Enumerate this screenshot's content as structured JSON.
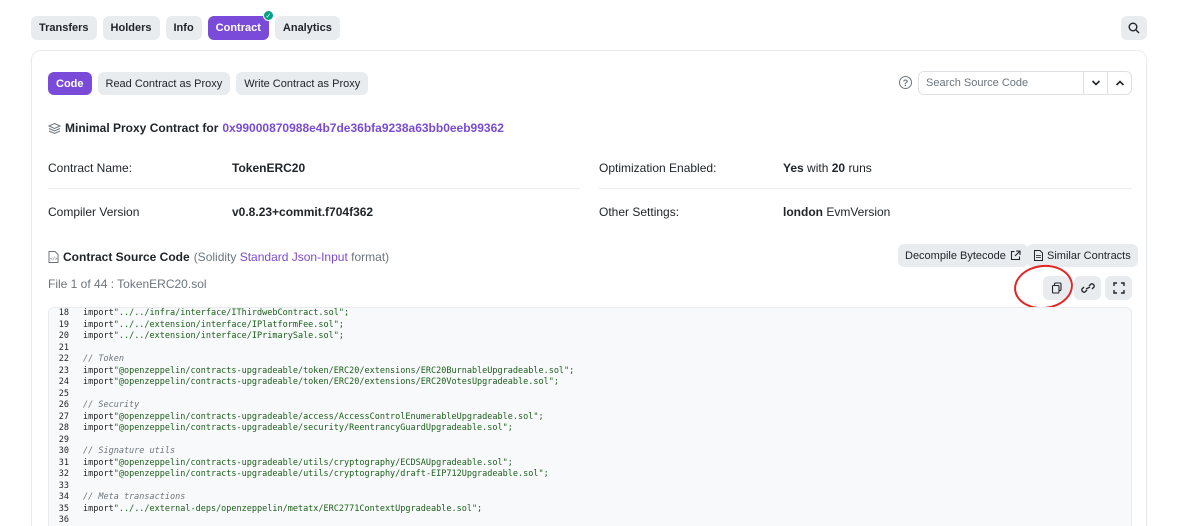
{
  "tabs": [
    {
      "label": "Transfers"
    },
    {
      "label": "Holders"
    },
    {
      "label": "Info"
    },
    {
      "label": "Contract",
      "active": true
    },
    {
      "label": "Analytics"
    }
  ],
  "subtabs": [
    {
      "label": "Code",
      "active": true
    },
    {
      "label": "Read Contract as Proxy"
    },
    {
      "label": "Write Contract as Proxy"
    }
  ],
  "search": {
    "placeholder": "Search Source Code",
    "down": "⌄",
    "up": "⌃"
  },
  "proxy": {
    "prefix": "Minimal Proxy Contract for",
    "address": "0x99000870988e4b7de36bfa9238a63bb0eeb99362"
  },
  "details": {
    "contract_name_label": "Contract Name:",
    "contract_name_value": "TokenERC20",
    "optimization_label": "Optimization Enabled:",
    "optimization_value_bold": "Yes",
    "optimization_value_mid": "with",
    "optimization_runs": "20",
    "optimization_suffix": "runs",
    "compiler_label": "Compiler Version",
    "compiler_value": "v0.8.23+commit.f704f362",
    "settings_label": "Other Settings:",
    "settings_value_bold": "london",
    "settings_value_rest": "EvmVersion"
  },
  "source": {
    "title": "Contract Source Code",
    "format_open": "(Solidity",
    "format_link": "Standard Json-Input",
    "format_close": "format)",
    "decompile_label": "Decompile Bytecode",
    "similar_label": "Similar Contracts",
    "file_info": "File 1 of 44 : TokenERC20.sol"
  },
  "code_lines": [
    {
      "n": "18",
      "type": "import",
      "path": "\"../../infra/interface/IThirdwebContract.sol\";"
    },
    {
      "n": "19",
      "type": "import",
      "path": "\"../../extension/interface/IPlatformFee.sol\";"
    },
    {
      "n": "20",
      "type": "import",
      "path": "\"../../extension/interface/IPrimarySale.sol\";"
    },
    {
      "n": "21",
      "type": "blank",
      "path": ""
    },
    {
      "n": "22",
      "type": "comment",
      "path": "// Token"
    },
    {
      "n": "23",
      "type": "import",
      "path": "\"@openzeppelin/contracts-upgradeable/token/ERC20/extensions/ERC20BurnableUpgradeable.sol\";"
    },
    {
      "n": "24",
      "type": "import",
      "path": "\"@openzeppelin/contracts-upgradeable/token/ERC20/extensions/ERC20VotesUpgradeable.sol\";"
    },
    {
      "n": "25",
      "type": "blank",
      "path": ""
    },
    {
      "n": "26",
      "type": "comment",
      "path": "// Security"
    },
    {
      "n": "27",
      "type": "import",
      "path": "\"@openzeppelin/contracts-upgradeable/access/AccessControlEnumerableUpgradeable.sol\";"
    },
    {
      "n": "28",
      "type": "import",
      "path": "\"@openzeppelin/contracts-upgradeable/security/ReentrancyGuardUpgradeable.sol\";"
    },
    {
      "n": "29",
      "type": "blank",
      "path": ""
    },
    {
      "n": "30",
      "type": "comment",
      "path": "// Signature utils"
    },
    {
      "n": "31",
      "type": "import",
      "path": "\"@openzeppelin/contracts-upgradeable/utils/cryptography/ECDSAUpgradeable.sol\";"
    },
    {
      "n": "32",
      "type": "import",
      "path": "\"@openzeppelin/contracts-upgradeable/utils/cryptography/draft-EIP712Upgradeable.sol\";"
    },
    {
      "n": "33",
      "type": "blank",
      "path": ""
    },
    {
      "n": "34",
      "type": "comment",
      "path": "// Meta transactions"
    },
    {
      "n": "35",
      "type": "import",
      "path": "\"../../external-deps/openzeppelin/metatx/ERC2771ContextUpgradeable.sol\";"
    },
    {
      "n": "36",
      "type": "blank",
      "path": ""
    }
  ],
  "import_keyword": "import",
  "colors": {
    "accent": "#7a4ad8",
    "annotation": "#e32525",
    "verified": "#00a186"
  }
}
